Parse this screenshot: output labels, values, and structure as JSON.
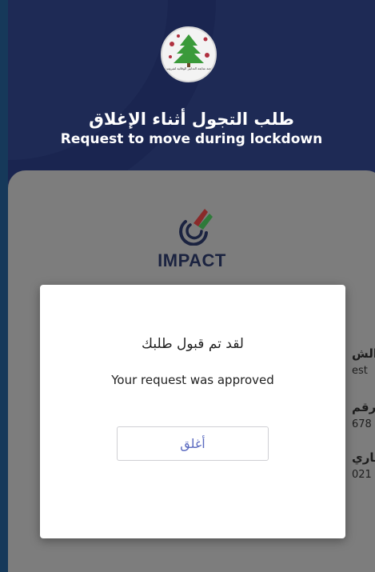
{
  "header": {
    "title_ar": "طلب التجول أثناء الإغلاق",
    "title_en": "Request to move during lockdown",
    "logo_icon": "lebanon-cedar-icon",
    "logo_caption": "لجنة متابعة التدابير الوقائية لفيروس"
  },
  "brand": {
    "name": "IMPACT",
    "icon": "impact-logo-icon"
  },
  "fields": [
    {
      "label": "الش",
      "value": "est"
    },
    {
      "label": "رقم",
      "value": "678"
    },
    {
      "label": "تاري",
      "value": "021"
    }
  ],
  "modal": {
    "message_ar": "لقد تم قبول طلبك",
    "message_en": "Your request was approved",
    "close_label": "أغلق"
  },
  "colors": {
    "header_bg": "#1e2a55",
    "card_dim": "#7d7d7d",
    "button_text": "#5c6bc0",
    "cedar_green": "#3a9a3a",
    "virus_red": "#b03040"
  }
}
